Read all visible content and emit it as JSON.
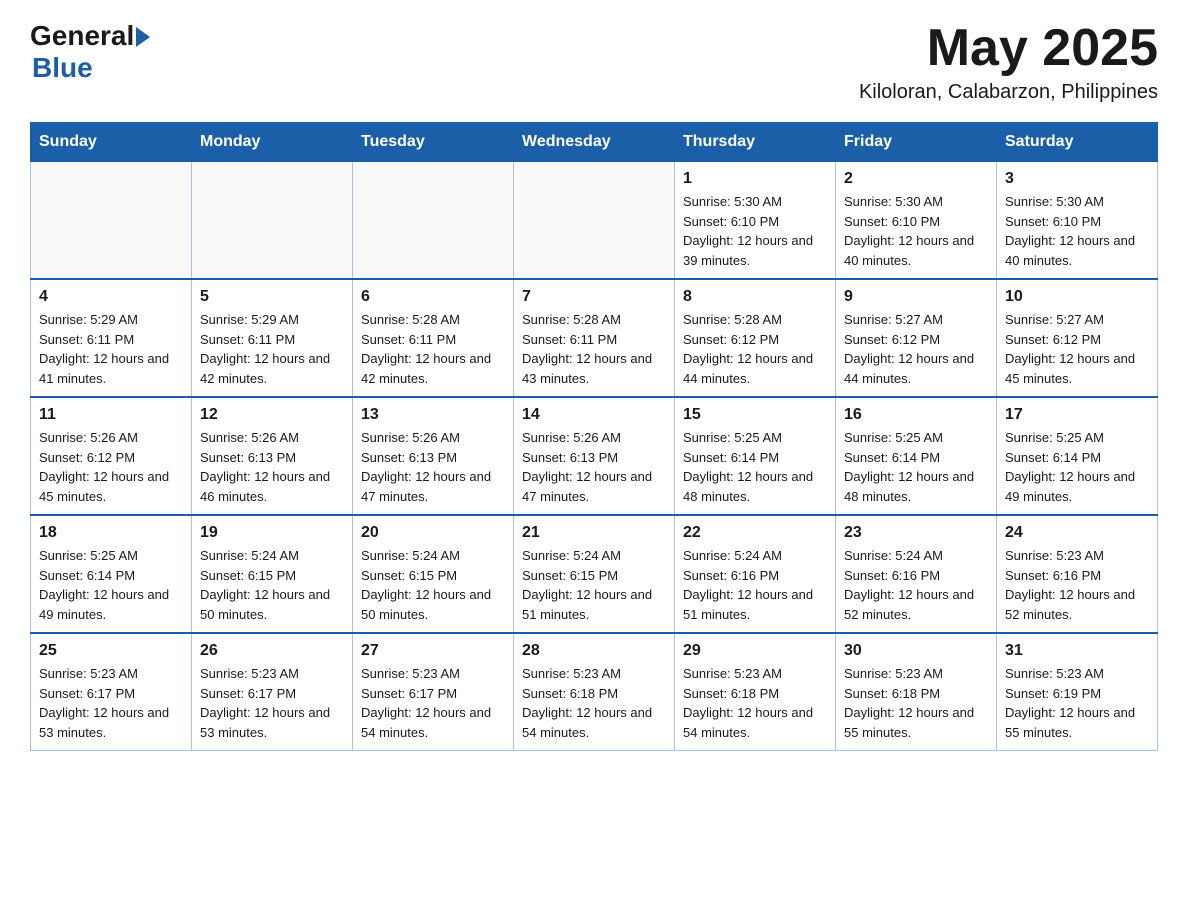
{
  "header": {
    "logo_general": "General",
    "logo_blue": "Blue",
    "month_title": "May 2025",
    "subtitle": "Kiloloran, Calabarzon, Philippines"
  },
  "days_of_week": [
    "Sunday",
    "Monday",
    "Tuesday",
    "Wednesday",
    "Thursday",
    "Friday",
    "Saturday"
  ],
  "weeks": [
    [
      {
        "day": "",
        "info": ""
      },
      {
        "day": "",
        "info": ""
      },
      {
        "day": "",
        "info": ""
      },
      {
        "day": "",
        "info": ""
      },
      {
        "day": "1",
        "info": "Sunrise: 5:30 AM\nSunset: 6:10 PM\nDaylight: 12 hours and 39 minutes."
      },
      {
        "day": "2",
        "info": "Sunrise: 5:30 AM\nSunset: 6:10 PM\nDaylight: 12 hours and 40 minutes."
      },
      {
        "day": "3",
        "info": "Sunrise: 5:30 AM\nSunset: 6:10 PM\nDaylight: 12 hours and 40 minutes."
      }
    ],
    [
      {
        "day": "4",
        "info": "Sunrise: 5:29 AM\nSunset: 6:11 PM\nDaylight: 12 hours and 41 minutes."
      },
      {
        "day": "5",
        "info": "Sunrise: 5:29 AM\nSunset: 6:11 PM\nDaylight: 12 hours and 42 minutes."
      },
      {
        "day": "6",
        "info": "Sunrise: 5:28 AM\nSunset: 6:11 PM\nDaylight: 12 hours and 42 minutes."
      },
      {
        "day": "7",
        "info": "Sunrise: 5:28 AM\nSunset: 6:11 PM\nDaylight: 12 hours and 43 minutes."
      },
      {
        "day": "8",
        "info": "Sunrise: 5:28 AM\nSunset: 6:12 PM\nDaylight: 12 hours and 44 minutes."
      },
      {
        "day": "9",
        "info": "Sunrise: 5:27 AM\nSunset: 6:12 PM\nDaylight: 12 hours and 44 minutes."
      },
      {
        "day": "10",
        "info": "Sunrise: 5:27 AM\nSunset: 6:12 PM\nDaylight: 12 hours and 45 minutes."
      }
    ],
    [
      {
        "day": "11",
        "info": "Sunrise: 5:26 AM\nSunset: 6:12 PM\nDaylight: 12 hours and 45 minutes."
      },
      {
        "day": "12",
        "info": "Sunrise: 5:26 AM\nSunset: 6:13 PM\nDaylight: 12 hours and 46 minutes."
      },
      {
        "day": "13",
        "info": "Sunrise: 5:26 AM\nSunset: 6:13 PM\nDaylight: 12 hours and 47 minutes."
      },
      {
        "day": "14",
        "info": "Sunrise: 5:26 AM\nSunset: 6:13 PM\nDaylight: 12 hours and 47 minutes."
      },
      {
        "day": "15",
        "info": "Sunrise: 5:25 AM\nSunset: 6:14 PM\nDaylight: 12 hours and 48 minutes."
      },
      {
        "day": "16",
        "info": "Sunrise: 5:25 AM\nSunset: 6:14 PM\nDaylight: 12 hours and 48 minutes."
      },
      {
        "day": "17",
        "info": "Sunrise: 5:25 AM\nSunset: 6:14 PM\nDaylight: 12 hours and 49 minutes."
      }
    ],
    [
      {
        "day": "18",
        "info": "Sunrise: 5:25 AM\nSunset: 6:14 PM\nDaylight: 12 hours and 49 minutes."
      },
      {
        "day": "19",
        "info": "Sunrise: 5:24 AM\nSunset: 6:15 PM\nDaylight: 12 hours and 50 minutes."
      },
      {
        "day": "20",
        "info": "Sunrise: 5:24 AM\nSunset: 6:15 PM\nDaylight: 12 hours and 50 minutes."
      },
      {
        "day": "21",
        "info": "Sunrise: 5:24 AM\nSunset: 6:15 PM\nDaylight: 12 hours and 51 minutes."
      },
      {
        "day": "22",
        "info": "Sunrise: 5:24 AM\nSunset: 6:16 PM\nDaylight: 12 hours and 51 minutes."
      },
      {
        "day": "23",
        "info": "Sunrise: 5:24 AM\nSunset: 6:16 PM\nDaylight: 12 hours and 52 minutes."
      },
      {
        "day": "24",
        "info": "Sunrise: 5:23 AM\nSunset: 6:16 PM\nDaylight: 12 hours and 52 minutes."
      }
    ],
    [
      {
        "day": "25",
        "info": "Sunrise: 5:23 AM\nSunset: 6:17 PM\nDaylight: 12 hours and 53 minutes."
      },
      {
        "day": "26",
        "info": "Sunrise: 5:23 AM\nSunset: 6:17 PM\nDaylight: 12 hours and 53 minutes."
      },
      {
        "day": "27",
        "info": "Sunrise: 5:23 AM\nSunset: 6:17 PM\nDaylight: 12 hours and 54 minutes."
      },
      {
        "day": "28",
        "info": "Sunrise: 5:23 AM\nSunset: 6:18 PM\nDaylight: 12 hours and 54 minutes."
      },
      {
        "day": "29",
        "info": "Sunrise: 5:23 AM\nSunset: 6:18 PM\nDaylight: 12 hours and 54 minutes."
      },
      {
        "day": "30",
        "info": "Sunrise: 5:23 AM\nSunset: 6:18 PM\nDaylight: 12 hours and 55 minutes."
      },
      {
        "day": "31",
        "info": "Sunrise: 5:23 AM\nSunset: 6:19 PM\nDaylight: 12 hours and 55 minutes."
      }
    ]
  ]
}
